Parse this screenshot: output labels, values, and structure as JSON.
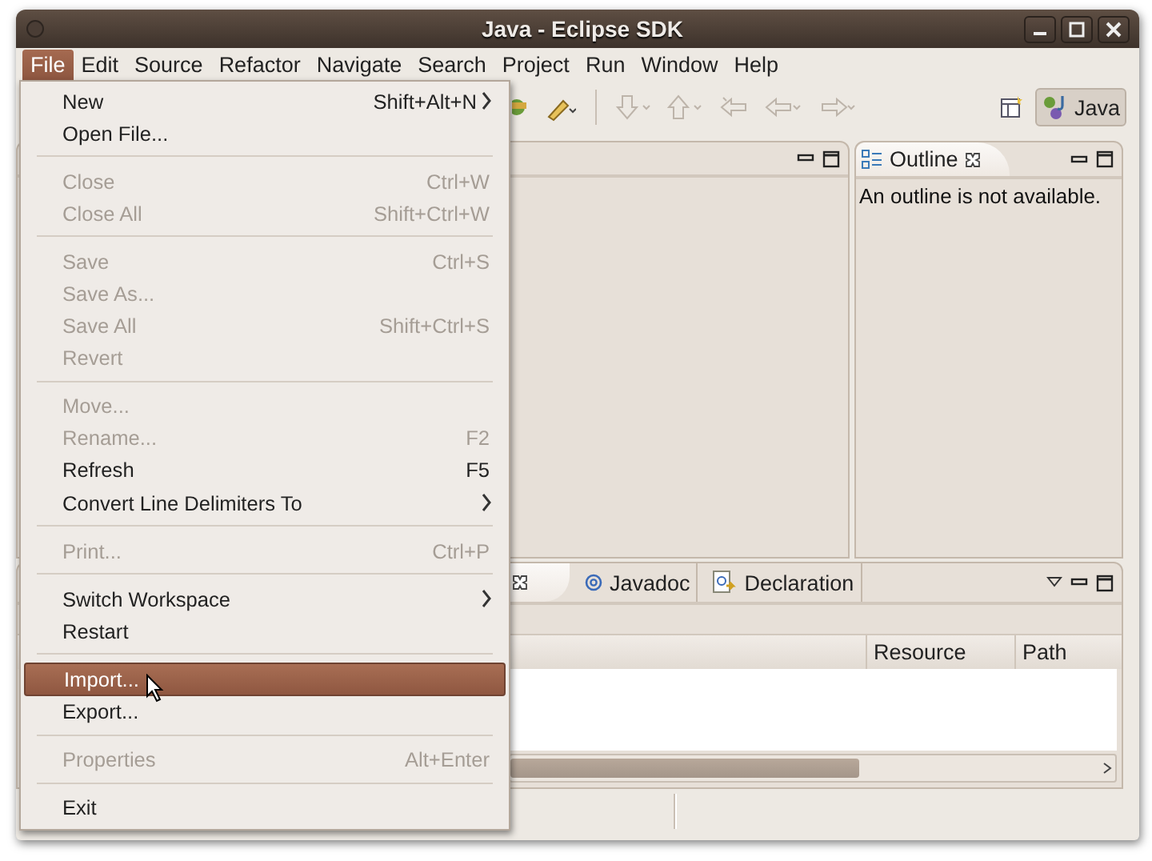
{
  "window": {
    "title": "Java - Eclipse SDK"
  },
  "menubar": [
    {
      "label": "File",
      "selected": true
    },
    {
      "label": "Edit",
      "selected": false
    },
    {
      "label": "Source",
      "selected": false
    },
    {
      "label": "Refactor",
      "selected": false
    },
    {
      "label": "Navigate",
      "selected": false
    },
    {
      "label": "Search",
      "selected": false
    },
    {
      "label": "Project",
      "selected": false
    },
    {
      "label": "Run",
      "selected": false
    },
    {
      "label": "Window",
      "selected": false
    },
    {
      "label": "Help",
      "selected": false
    }
  ],
  "file_menu": [
    {
      "kind": "item",
      "label": "New",
      "shortcut": "Shift+Alt+N",
      "disabled": false,
      "submenu": true,
      "selected": false
    },
    {
      "kind": "item",
      "label": "Open File...",
      "disabled": false,
      "selected": false
    },
    {
      "kind": "separator"
    },
    {
      "kind": "item",
      "label": "Close",
      "shortcut": "Ctrl+W",
      "disabled": true,
      "selected": false
    },
    {
      "kind": "item",
      "label": "Close All",
      "shortcut": "Shift+Ctrl+W",
      "disabled": true,
      "selected": false
    },
    {
      "kind": "separator"
    },
    {
      "kind": "item",
      "label": "Save",
      "shortcut": "Ctrl+S",
      "disabled": true,
      "selected": false
    },
    {
      "kind": "item",
      "label": "Save As...",
      "disabled": true,
      "selected": false
    },
    {
      "kind": "item",
      "label": "Save All",
      "shortcut": "Shift+Ctrl+S",
      "disabled": true,
      "selected": false
    },
    {
      "kind": "item",
      "label": "Revert",
      "disabled": true,
      "selected": false
    },
    {
      "kind": "separator"
    },
    {
      "kind": "item",
      "label": "Move...",
      "disabled": true,
      "selected": false
    },
    {
      "kind": "item",
      "label": "Rename...",
      "shortcut": "F2",
      "disabled": true,
      "selected": false
    },
    {
      "kind": "item",
      "label": "Refresh",
      "shortcut": "F5",
      "disabled": false,
      "selected": false
    },
    {
      "kind": "item",
      "label": "Convert Line Delimiters To",
      "disabled": false,
      "submenu": true,
      "selected": false
    },
    {
      "kind": "separator"
    },
    {
      "kind": "item",
      "label": "Print...",
      "shortcut": "Ctrl+P",
      "disabled": true,
      "selected": false
    },
    {
      "kind": "separator"
    },
    {
      "kind": "item",
      "label": "Switch Workspace",
      "disabled": false,
      "submenu": true,
      "selected": false
    },
    {
      "kind": "item",
      "label": "Restart",
      "disabled": false,
      "selected": false
    },
    {
      "kind": "separator"
    },
    {
      "kind": "item",
      "label": "Import...",
      "disabled": false,
      "selected": true
    },
    {
      "kind": "item",
      "label": "Export...",
      "disabled": false,
      "selected": false
    },
    {
      "kind": "separator"
    },
    {
      "kind": "item",
      "label": "Properties",
      "shortcut": "Alt+Enter",
      "disabled": true,
      "selected": false
    },
    {
      "kind": "separator"
    },
    {
      "kind": "item",
      "label": "Exit",
      "disabled": false,
      "selected": false
    }
  ],
  "toolbar": {
    "perspective": {
      "label": "Java",
      "selected": true
    }
  },
  "outline": {
    "tab": "Outline",
    "message": "An outline is not available."
  },
  "bottom_panel": {
    "tabs": [
      {
        "label": "Javadoc",
        "selected": false,
        "kind": "javadoc"
      },
      {
        "label": "Declaration",
        "selected": false,
        "kind": "declaration"
      }
    ],
    "columns": [
      "Resource",
      "Path"
    ]
  }
}
